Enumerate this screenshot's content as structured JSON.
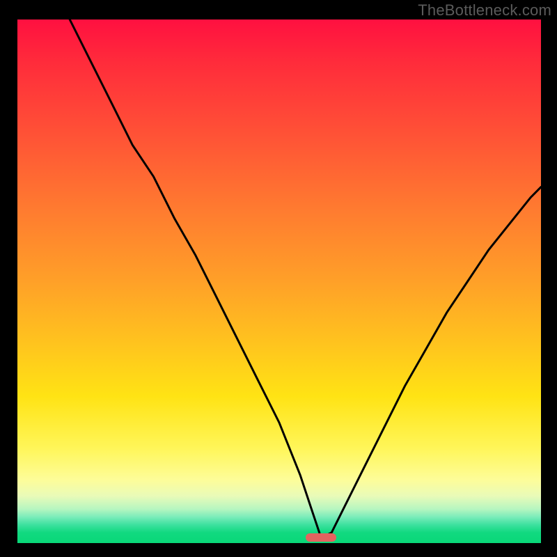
{
  "watermark": "TheBottleneck.com",
  "colors": {
    "curve_stroke": "#000000",
    "pill": "#e4635f",
    "background_black": "#000000"
  },
  "chart_data": {
    "type": "line",
    "title": "",
    "xlabel": "",
    "ylabel": "",
    "xlim": [
      0,
      100
    ],
    "ylim": [
      0,
      100
    ],
    "grid": false,
    "legend": false,
    "annotations": [
      {
        "text": "TheBottleneck.com",
        "pos": "top-right"
      }
    ],
    "notes": "Background is a vertical red→orange→yellow→green gradient. No axis tick labels are shown; curve values are estimated from pixel positions against the gradient frame (x,y both 0–100, y=0 at bottom).",
    "indicator": {
      "x": 58,
      "y": 1,
      "type": "pill",
      "color": "#e4635f"
    },
    "series": [
      {
        "name": "curve",
        "type": "line",
        "color": "#000000",
        "x": [
          10,
          14,
          18,
          22,
          26,
          30,
          34,
          38,
          42,
          46,
          50,
          54,
          56,
          58,
          60,
          62,
          66,
          70,
          74,
          78,
          82,
          86,
          90,
          94,
          98,
          100
        ],
        "y": [
          100,
          92,
          84,
          76,
          70,
          62,
          55,
          47,
          39,
          31,
          23,
          13,
          7,
          1,
          2,
          6,
          14,
          22,
          30,
          37,
          44,
          50,
          56,
          61,
          66,
          68
        ]
      }
    ]
  }
}
